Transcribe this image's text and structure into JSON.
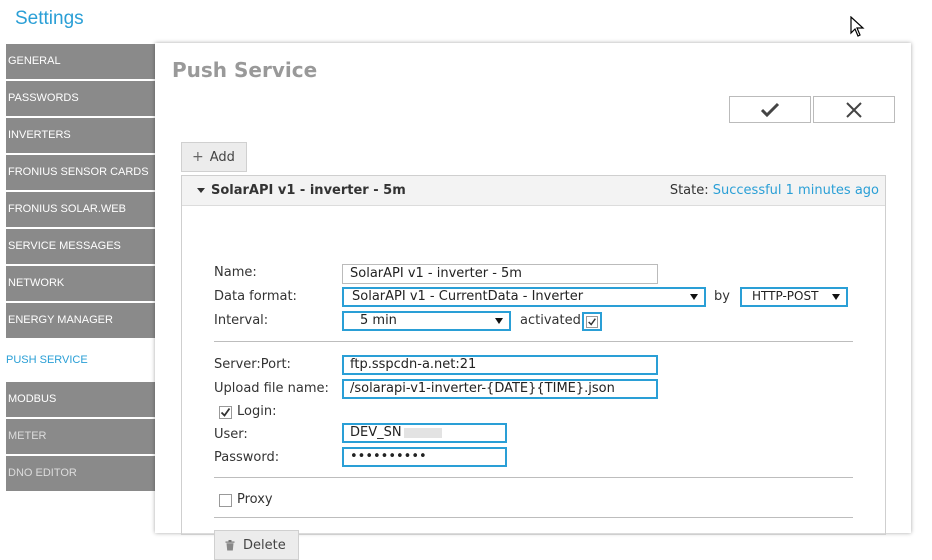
{
  "app": {
    "title": "Settings"
  },
  "sidebar": {
    "items": [
      {
        "label": "GENERAL",
        "state": "normal"
      },
      {
        "label": "PASSWORDS",
        "state": "normal"
      },
      {
        "label": "INVERTERS",
        "state": "normal"
      },
      {
        "label": "FRONIUS SENSOR CARDS",
        "state": "normal"
      },
      {
        "label": "FRONIUS SOLAR.WEB",
        "state": "normal"
      },
      {
        "label": "SERVICE MESSAGES",
        "state": "normal"
      },
      {
        "label": "NETWORK",
        "state": "normal"
      },
      {
        "label": "ENERGY MANAGER",
        "state": "normal"
      },
      {
        "label": "PUSH SERVICE",
        "state": "active"
      },
      {
        "label": "MODBUS",
        "state": "normal"
      },
      {
        "label": "METER",
        "state": "disabled"
      },
      {
        "label": "DNO EDITOR",
        "state": "disabled"
      }
    ]
  },
  "panel": {
    "title": "Push Service",
    "confirm_icon": "checkmark-icon",
    "cancel_icon": "close-icon",
    "add_label": "Add"
  },
  "service": {
    "name": "SolarAPI v1 - inverter - 5m",
    "state_label": "State:",
    "state_value": "Successful 1 minutes ago",
    "form": {
      "name_label": "Name:",
      "name_value": "SolarAPI v1 - inverter - 5m",
      "data_format_label": "Data format:",
      "data_format_value": "SolarAPI v1 - CurrentData - Inverter",
      "by_label": "by",
      "method_value": "HTTP-POST",
      "interval_label": "Interval:",
      "interval_value": "5 min",
      "activated_label": "activated",
      "activated": true,
      "server_label": "Server:Port:",
      "server_value": "ftp.sspcdn-a.net:21",
      "upload_label": "Upload file name:",
      "upload_value": "/solarapi-v1-inverter-{DATE}{TIME}.json",
      "login_label": "Login:",
      "login_checked": true,
      "user_label": "User:",
      "user_value": "DEV_SN",
      "password_label": "Password:",
      "password_value": "••••••••••",
      "proxy_label": "Proxy",
      "proxy_checked": false,
      "delete_label": "Delete"
    }
  },
  "colors": {
    "accent": "#2a9fd6",
    "nav_bg": "#8a8a8a"
  }
}
